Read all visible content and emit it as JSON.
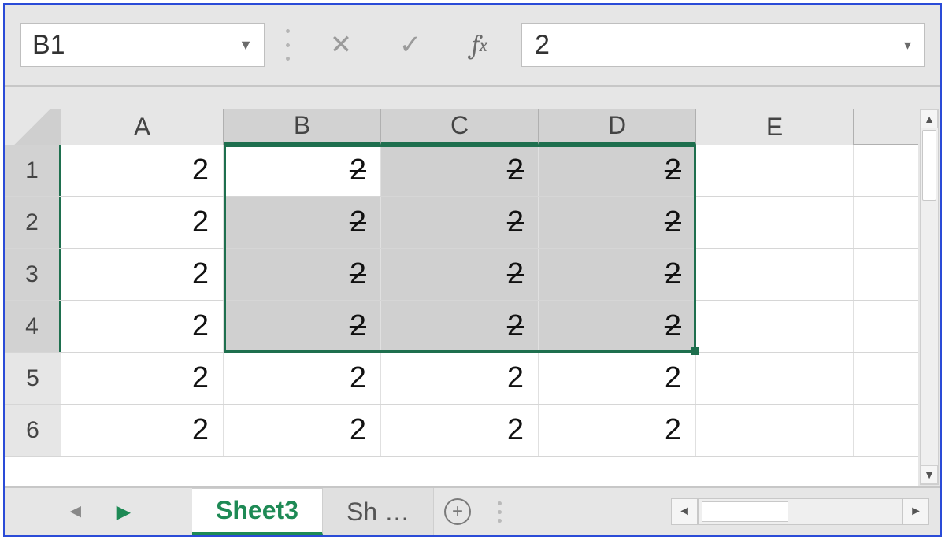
{
  "formula_bar": {
    "name_box": "B1",
    "formula_value": "2"
  },
  "columns": [
    {
      "id": "A",
      "label": "A",
      "selected": false
    },
    {
      "id": "B",
      "label": "B",
      "selected": true
    },
    {
      "id": "C",
      "label": "C",
      "selected": true
    },
    {
      "id": "D",
      "label": "D",
      "selected": true
    },
    {
      "id": "E",
      "label": "E",
      "selected": false
    }
  ],
  "rows": [
    {
      "n": "1",
      "selected": true
    },
    {
      "n": "2",
      "selected": true
    },
    {
      "n": "3",
      "selected": true
    },
    {
      "n": "4",
      "selected": true
    },
    {
      "n": "5",
      "selected": false
    },
    {
      "n": "6",
      "selected": false
    }
  ],
  "cells": {
    "A": [
      "2",
      "2",
      "2",
      "2",
      "2",
      "2"
    ],
    "B": [
      "2",
      "2",
      "2",
      "2",
      "2",
      "2"
    ],
    "C": [
      "2",
      "2",
      "2",
      "2",
      "2",
      "2"
    ],
    "D": [
      "2",
      "2",
      "2",
      "2",
      "2",
      "2"
    ],
    "E": [
      "",
      "",
      "",
      "",
      "",
      ""
    ]
  },
  "selection": {
    "cols": [
      "B",
      "C",
      "D"
    ],
    "rows": [
      1,
      2,
      3,
      4
    ],
    "active": "B1"
  },
  "strikethrough_region": {
    "cols": [
      "B",
      "C",
      "D"
    ],
    "rows": [
      1,
      2,
      3,
      4
    ]
  },
  "sheets": {
    "active": "Sheet3",
    "others": [
      "Sh …"
    ]
  }
}
